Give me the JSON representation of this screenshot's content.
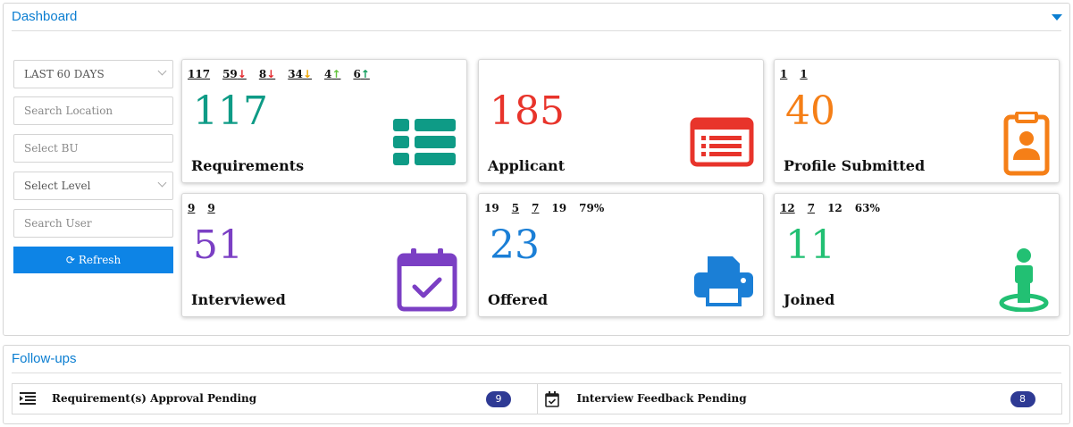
{
  "dashboard": {
    "title": "Dashboard",
    "filters": {
      "period": "LAST 60 DAYS",
      "location_placeholder": "Search Location",
      "bu_placeholder": "Select BU",
      "level": "Select Level",
      "user_placeholder": "Search User",
      "refresh_label": "Refresh"
    },
    "cards": [
      {
        "label": "Requirements",
        "value": "117",
        "color": "#0e9b86",
        "icon": "list-icon",
        "stats": [
          {
            "text": "117",
            "arrow": ""
          },
          {
            "text": "59",
            "arrow": "down",
            "arrow_color": "#e3262b"
          },
          {
            "text": "8",
            "arrow": "down",
            "arrow_color": "#e3262b"
          },
          {
            "text": "34",
            "arrow": "down",
            "arrow_color": "#f0a500"
          },
          {
            "text": "4",
            "arrow": "up",
            "arrow_color": "#63c33d"
          },
          {
            "text": "6",
            "arrow": "up",
            "arrow_color": "#0e9b5a"
          }
        ]
      },
      {
        "label": "Applicant",
        "value": "185",
        "color": "#e8342b",
        "icon": "id-card-icon",
        "stats": []
      },
      {
        "label": "Profile Submitted",
        "value": "40",
        "color": "#f57f17",
        "icon": "badge-icon",
        "stats": [
          {
            "text": "1",
            "arrow": ""
          },
          {
            "text": "1",
            "arrow": ""
          }
        ]
      },
      {
        "label": "Interviewed",
        "value": "51",
        "color": "#7b3fc4",
        "icon": "calendar-check-icon",
        "stats": [
          {
            "text": "9",
            "arrow": ""
          },
          {
            "text": "9",
            "arrow": ""
          }
        ]
      },
      {
        "label": "Offered",
        "value": "23",
        "color": "#1b7fd6",
        "icon": "printer-icon",
        "stats": [
          {
            "text": "19",
            "arrow": "",
            "plain": true
          },
          {
            "text": "5",
            "arrow": ""
          },
          {
            "text": "7",
            "arrow": ""
          },
          {
            "text": "19",
            "arrow": "",
            "plain": true
          },
          {
            "text": "79%",
            "arrow": "",
            "plain": true
          }
        ]
      },
      {
        "label": "Joined",
        "value": "11",
        "color": "#22c073",
        "icon": "person-pin-icon",
        "stats": [
          {
            "text": "12",
            "arrow": ""
          },
          {
            "text": "7",
            "arrow": ""
          },
          {
            "text": "12",
            "arrow": "",
            "plain": true
          },
          {
            "text": "63%",
            "arrow": "",
            "plain": true
          }
        ]
      }
    ]
  },
  "followups": {
    "title": "Follow-ups",
    "items": [
      {
        "label": "Requirement(s) Approval Pending",
        "count": "9",
        "icon": "indent-list-icon"
      },
      {
        "label": "Interview Feedback Pending",
        "count": "8",
        "icon": "calendar-check-icon"
      }
    ]
  }
}
